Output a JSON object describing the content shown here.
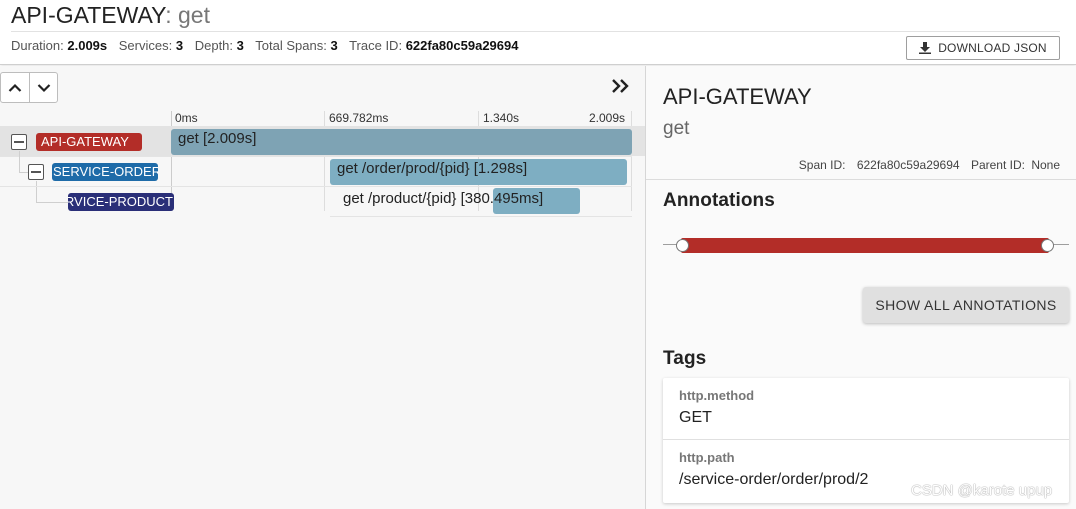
{
  "header": {
    "service": "API-GATEWAY",
    "separator": ": ",
    "operation": "get",
    "meta": [
      {
        "label": "Duration:",
        "value": "2.009s"
      },
      {
        "label": "Services:",
        "value": "3"
      },
      {
        "label": "Depth:",
        "value": "3"
      },
      {
        "label": "Total Spans:",
        "value": "3"
      },
      {
        "label": "Trace ID:",
        "value": "622fa80c59a29694"
      }
    ],
    "download_label": "DOWNLOAD JSON",
    "download_icon": "download-icon"
  },
  "timeline": {
    "ticks": [
      "0ms",
      "669.782ms",
      "1.340s",
      "2.009s"
    ],
    "expand_icon": "double-chevron-right-icon",
    "spans": [
      {
        "service": "API-GATEWAY",
        "label": "get [2.009s]",
        "color": "#b32d28"
      },
      {
        "service": "SERVICE-ORDER",
        "label": "get /order/prod/{pid} [1.298s]",
        "color": "#1e6ba8"
      },
      {
        "service": "SERVICE-PRODUCT",
        "label": "get /product/{pid} [380.495ms]",
        "color": "#2a2f78"
      }
    ]
  },
  "detail": {
    "service": "API-GATEWAY",
    "operation": "get",
    "span_id_label": "Span ID:",
    "span_id": "622fa80c59a29694",
    "parent_id_label": "Parent ID:",
    "parent_id": "None",
    "annotations_title": "Annotations",
    "annotation_color": "#b32d28",
    "show_all_label": "SHOW ALL ANNOTATIONS",
    "tags_title": "Tags",
    "tags": [
      {
        "key": "http.method",
        "value": "GET"
      },
      {
        "key": "http.path",
        "value": "/service-order/order/prod/2"
      }
    ]
  },
  "watermark": "CSDN @karote upup"
}
